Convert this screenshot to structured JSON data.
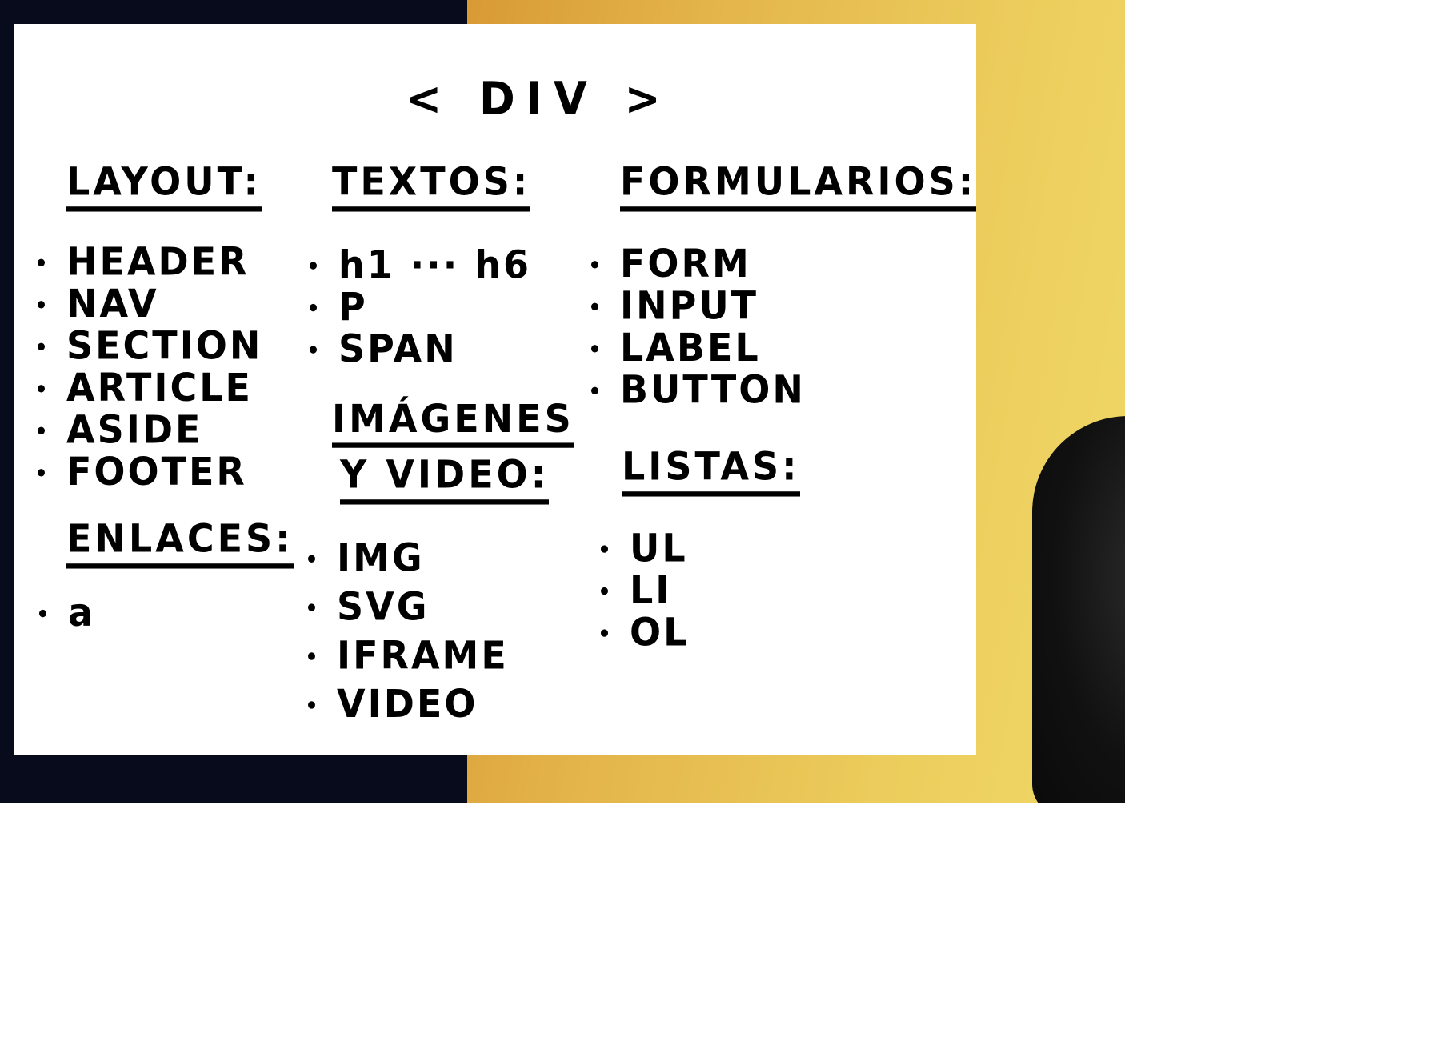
{
  "title": "< DIV >",
  "layout": {
    "heading": "LAYOUT:",
    "items": [
      "HEADER",
      "NAV",
      "SECTION",
      "ARTICLE",
      "ASIDE",
      "FOOTER"
    ]
  },
  "enlaces": {
    "heading": "ENLACES:",
    "items": [
      "a"
    ]
  },
  "textos": {
    "heading": "TEXTOS:",
    "items": [
      "h1 ··· h6",
      "P",
      "SPAN"
    ]
  },
  "imagenes": {
    "heading_line1": "IMÁGENES",
    "heading_line2": "Y VIDEO:",
    "items": [
      "IMG",
      "SVG",
      "IFRAME",
      "VIDEO"
    ]
  },
  "formularios": {
    "heading": "FORMULARIOS:",
    "items": [
      "FORM",
      "INPUT",
      "LABEL",
      "BUTTON"
    ]
  },
  "listas": {
    "heading": "LISTAS:",
    "items": [
      "UL",
      "LI",
      "OL"
    ]
  },
  "colors": {
    "background_dark": "#070b1c",
    "background_yellow": "#e3b44a",
    "board": "#ffffff",
    "ink": "#000000"
  }
}
